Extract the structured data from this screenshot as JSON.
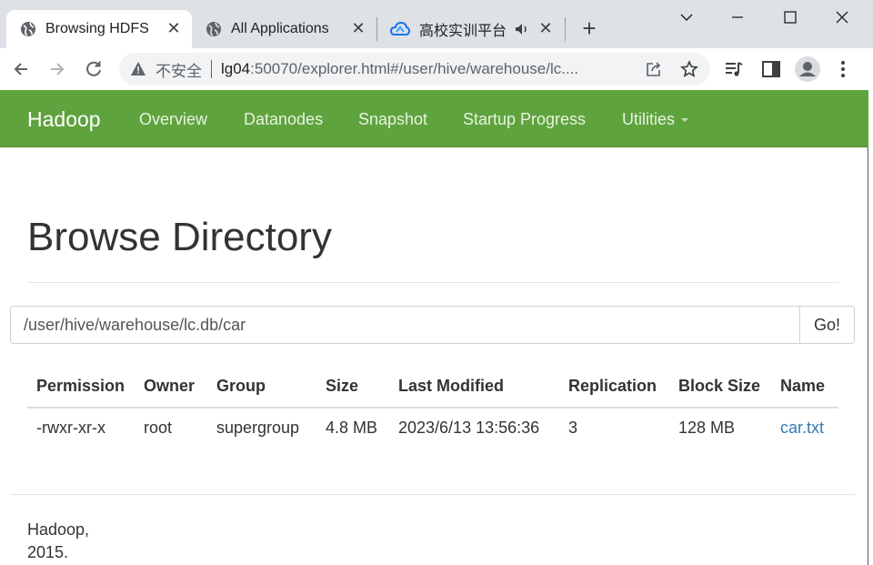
{
  "browser": {
    "tabs": [
      {
        "title": "Browsing HDFS",
        "active": true
      },
      {
        "title": "All Applications",
        "active": false
      },
      {
        "title": "高校实训平台",
        "active": false
      }
    ],
    "close_glyph": "✕",
    "new_tab_glyph": "+",
    "window_controls": {
      "minimize": "—",
      "maximize": "☐",
      "close": "✕"
    },
    "address": {
      "security_label": "不安全",
      "host": "lg04",
      "rest": ":50070/explorer.html#/user/hive/warehouse/lc...."
    },
    "icons": [
      "globe-icon",
      "cloud-icon",
      "speaker-icon",
      "back-icon",
      "forward-icon",
      "reload-icon",
      "warning-icon",
      "share-icon",
      "star-icon",
      "media-icon",
      "sidepanel-icon",
      "profile-icon",
      "menu-icon"
    ]
  },
  "navbar": {
    "brand": "Hadoop",
    "links": [
      "Overview",
      "Datanodes",
      "Snapshot",
      "Startup Progress",
      "Utilities"
    ],
    "color": "#5fa33e"
  },
  "page": {
    "title": "Browse Directory",
    "path_value": "/user/hive/warehouse/lc.db/car",
    "go_label": "Go!"
  },
  "table": {
    "headers": [
      "Permission",
      "Owner",
      "Group",
      "Size",
      "Last Modified",
      "Replication",
      "Block Size",
      "Name"
    ],
    "rows": [
      [
        "-rwxr-xr-x",
        "root",
        "supergroup",
        "4.8 MB",
        "2023/6/13 13:56:36",
        "3",
        "128 MB",
        "car.txt"
      ]
    ],
    "link_color": "#337ab7"
  },
  "footer": {
    "line1": "Hadoop,",
    "line2": "2015."
  }
}
